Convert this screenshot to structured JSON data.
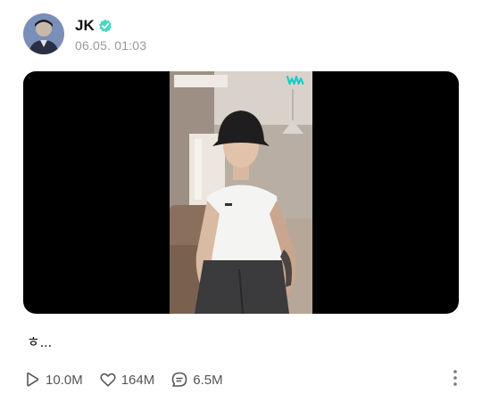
{
  "post": {
    "author": "JK",
    "verified_icon": "verified-badge-icon",
    "timestamp": "06.05. 01:03",
    "text": "ㅎ...",
    "video": {
      "watermark_icon": "weverse-logo-icon"
    }
  },
  "stats": {
    "views": "10.0M",
    "views_icon": "play-icon",
    "likes": "164M",
    "likes_icon": "heart-icon",
    "comments": "6.5M",
    "comments_icon": "comment-icon"
  },
  "more_icon": "more-vertical-icon",
  "colors": {
    "verified": "#4ed6c1",
    "accent": "#08ccca",
    "muted": "#9a9a9a",
    "video_bg": "#000000"
  }
}
